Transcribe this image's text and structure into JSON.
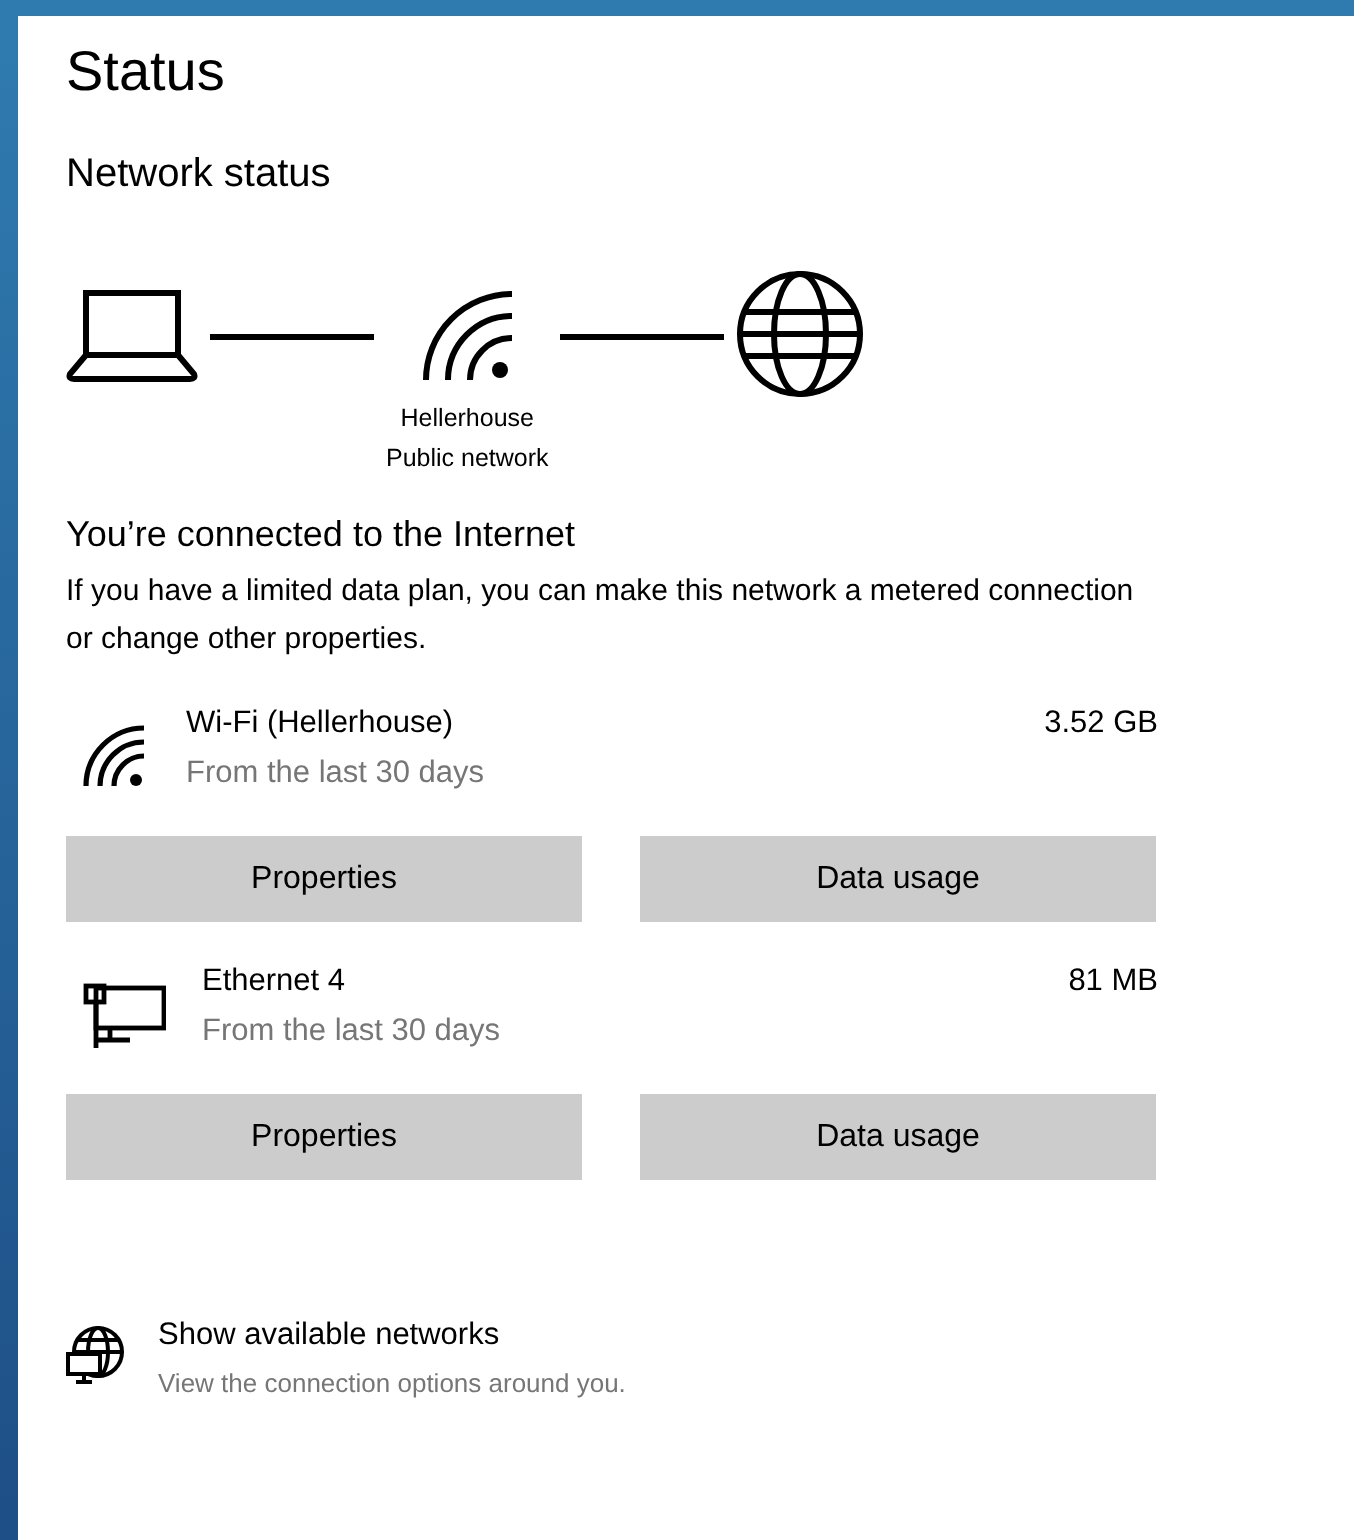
{
  "title": "Status",
  "section_title": "Network status",
  "diagram": {
    "network_name": "Hellerhouse",
    "network_type": "Public network"
  },
  "connected_heading": "You’re connected to the Internet",
  "connected_text": "If you have a limited data plan, you can make this network a metered connection or change other properties.",
  "connections": [
    {
      "kind": "wifi",
      "name": "Wi-Fi (Hellerhouse)",
      "period": "From the last 30 days",
      "usage": "3.52 GB",
      "buttons": [
        "Properties",
        "Data usage"
      ]
    },
    {
      "kind": "ethernet",
      "name": "Ethernet 4",
      "period": "From the last 30 days",
      "usage": "81 MB",
      "buttons": [
        "Properties",
        "Data usage"
      ]
    }
  ],
  "show_networks": {
    "title": "Show available networks",
    "subtitle": "View the connection options around you."
  }
}
